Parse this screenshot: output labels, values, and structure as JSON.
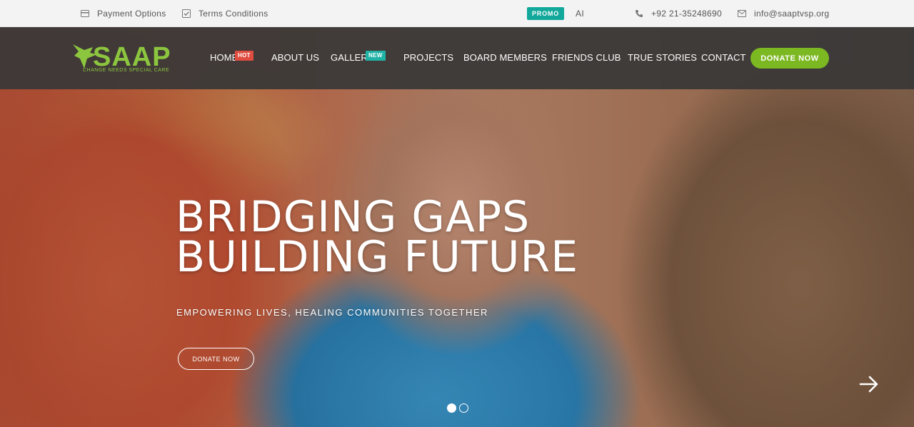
{
  "topbar": {
    "payment_options": "Payment Options",
    "terms_conditions": "Terms Conditions",
    "promo_badge": "PROMO",
    "promo_text": "AI",
    "phone": "+92 21-35248690",
    "email": "info@saaptvsp.org"
  },
  "logo": {
    "name": "SAAP",
    "tagline": "CHANGE NEEDS SPECIAL CARE",
    "color": "#8cc63f"
  },
  "nav": {
    "items": [
      {
        "label": "HOME",
        "badge": "HOT"
      },
      {
        "label": "ABOUT US"
      },
      {
        "label": "GALLERY",
        "badge": "NEW"
      },
      {
        "label": "PROJECTS"
      },
      {
        "label": "BOARD MEMBERS"
      },
      {
        "label": "FRIENDS CLUB"
      },
      {
        "label": "TRUE STORIES"
      },
      {
        "label": "CONTACT"
      }
    ],
    "donate_label": "DONATE NOW",
    "accent_color": "#7cb822"
  },
  "hero": {
    "title_line1": "BRIDGING GAPS",
    "title_line2": "BUILDING FUTURE",
    "subtitle": "EMPOWERING LIVES, HEALING COMMUNITIES TOGETHER",
    "button_label": "DONATE NOW",
    "slides_total": 2,
    "active_slide": 1
  },
  "icons": {
    "payment": "credit-card-icon",
    "terms": "checkbox-icon",
    "phone": "phone-icon",
    "email": "envelope-icon",
    "next": "arrow-right-icon"
  }
}
